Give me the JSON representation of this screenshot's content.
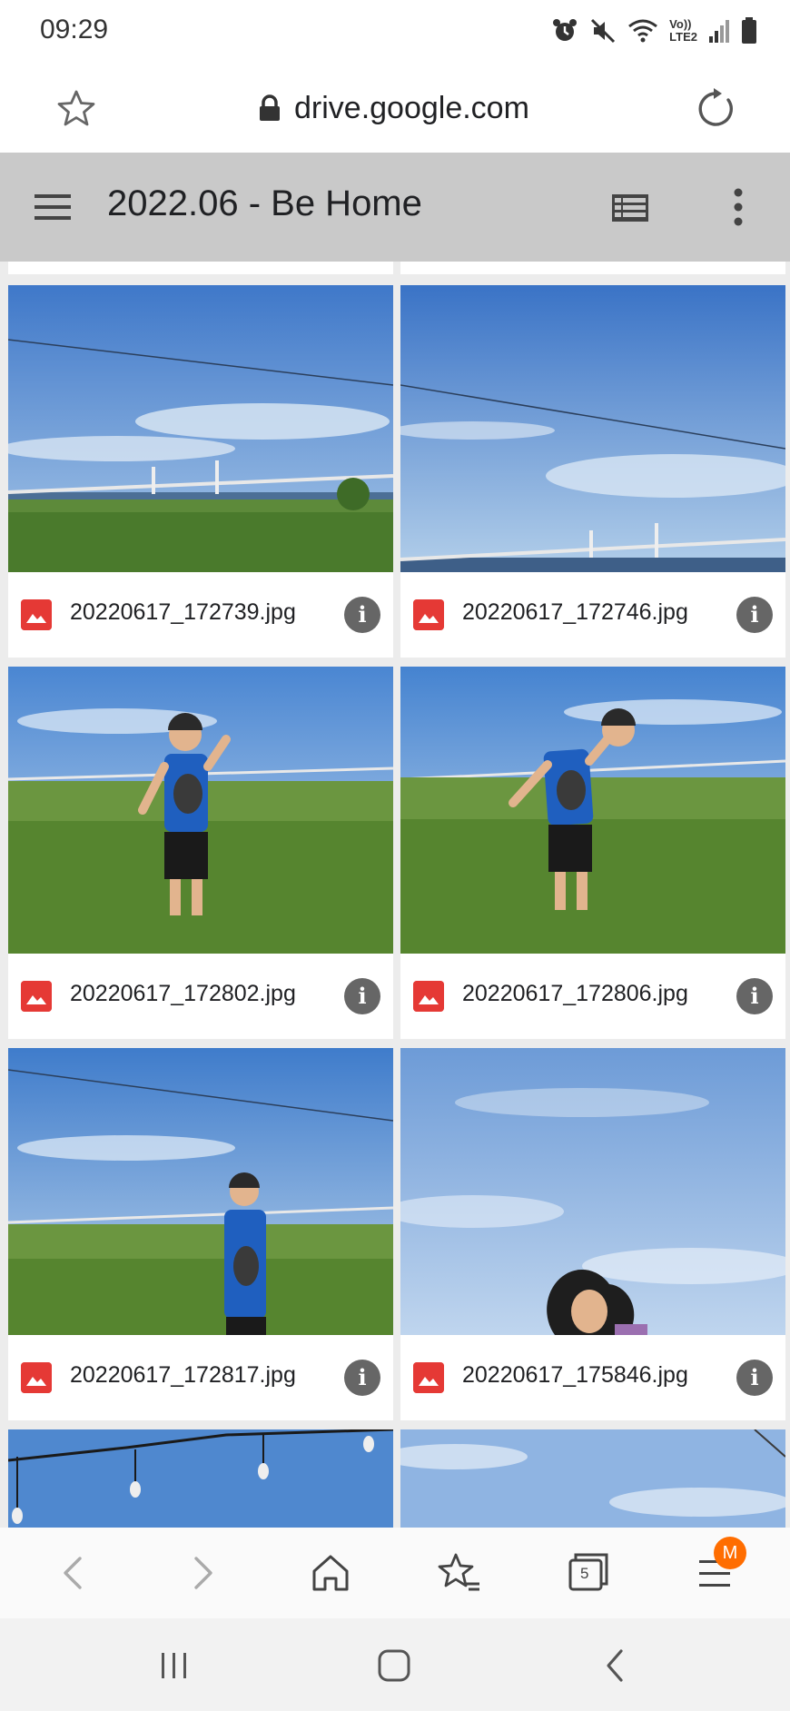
{
  "status_bar": {
    "time": "09:29",
    "network_label_top": "Vo))",
    "network_label_bottom": "LTE2",
    "icons": [
      "alarm-icon",
      "mute-icon",
      "wifi-icon",
      "signal-icon",
      "battery-icon"
    ]
  },
  "browser": {
    "url": "drive.google.com",
    "tab_count": "5",
    "menu_badge": "M",
    "accent_color": "#ff6d00"
  },
  "drive": {
    "folder_title": "2022.06 - Be Home",
    "files": [
      {
        "name": "20220617_172739.jpg",
        "thumb": "bridge-landscape-1"
      },
      {
        "name": "20220617_172746.jpg",
        "thumb": "bridge-landscape-2"
      },
      {
        "name": "20220617_172802.jpg",
        "thumb": "man-in-field-1"
      },
      {
        "name": "20220617_172806.jpg",
        "thumb": "man-in-field-2"
      },
      {
        "name": "20220617_172817.jpg",
        "thumb": "man-in-field-3"
      },
      {
        "name": "20220617_175846.jpg",
        "thumb": "woman-sky"
      }
    ],
    "info_glyph": "i",
    "file_icon_color": "#e53935"
  }
}
